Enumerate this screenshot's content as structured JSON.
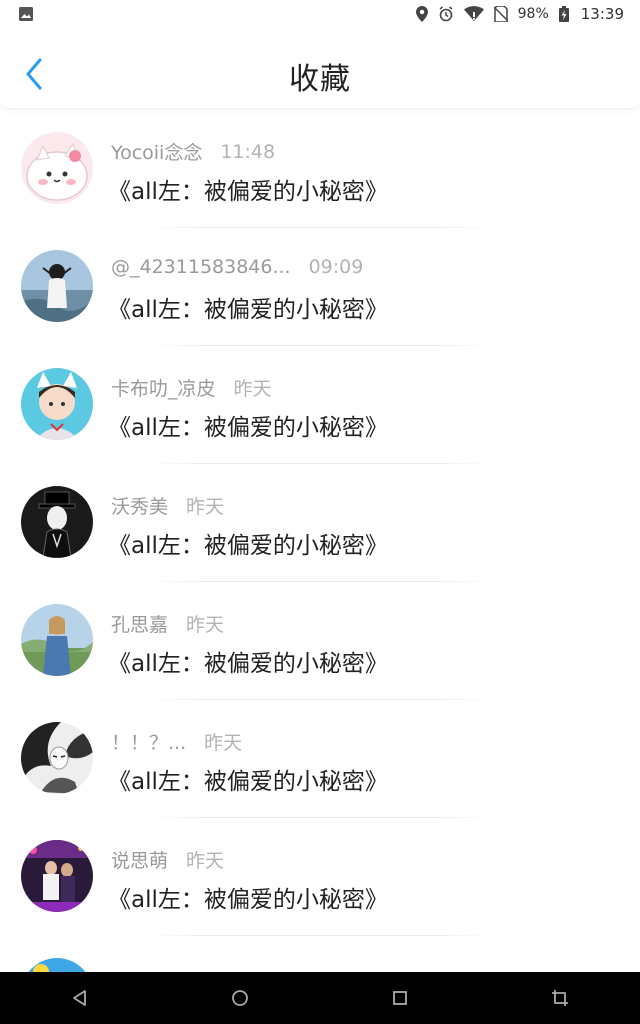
{
  "status_bar": {
    "battery_percent": "98%",
    "time": "13:39",
    "icons": [
      "image-icon",
      "location-icon",
      "alarm-icon",
      "wifi-icon",
      "no-sim-icon",
      "battery-charging-icon"
    ]
  },
  "header": {
    "title": "收藏",
    "back_icon": "chevron-left-icon",
    "accent_color": "#2a9cf3"
  },
  "items": [
    {
      "name": "Yocoii念念",
      "time": "11:48",
      "message": "《all左：被偏爱的小秘密》"
    },
    {
      "name": "@_42311583846...",
      "time": "09:09",
      "message": "《all左：被偏爱的小秘密》"
    },
    {
      "name": "卡布叻_凉皮",
      "time": "昨天",
      "message": "《all左：被偏爱的小秘密》"
    },
    {
      "name": "沃秀美",
      "time": "昨天",
      "message": "《all左：被偏爱的小秘密》"
    },
    {
      "name": "孔思嘉",
      "time": "昨天",
      "message": "《all左：被偏爱的小秘密》"
    },
    {
      "name": "！！？...",
      "time": "昨天",
      "message": "《all左：被偏爱的小秘密》"
    },
    {
      "name": "说思萌",
      "time": "昨天",
      "message": "《all左：被偏爱的小秘密》"
    }
  ],
  "nav_bar": {
    "icons": [
      "back-triangle-icon",
      "home-circle-icon",
      "recents-square-icon",
      "crop-icon"
    ]
  }
}
